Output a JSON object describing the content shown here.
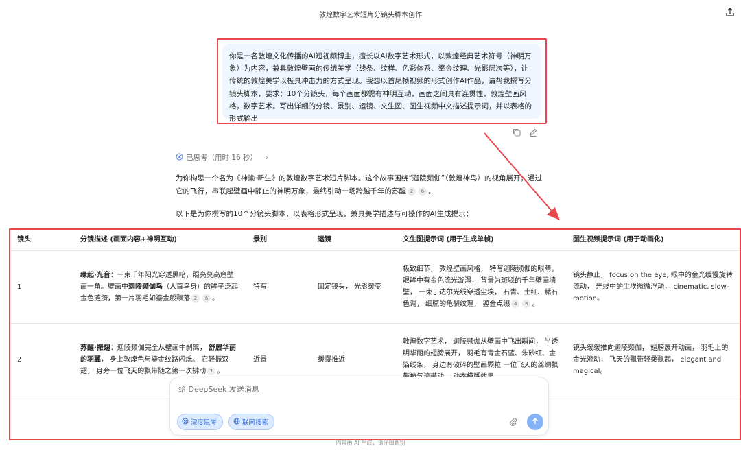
{
  "header": {
    "title": "敦煌数字艺术短片分镜头脚本创作"
  },
  "user_message": {
    "text": "你是一名敦煌文化传播的AI短视频博主，擅长以AI数字艺术形式，以敦煌经典艺术符号（神明万象）为内容，兼具敦煌壁画的传统美学（线条、纹样、色彩体系、鎏金纹理、光影层次等），让传统的敦煌美学以极具冲击力的方式呈现。我想以首尾帧视频的形式创作AI作品，请帮我撰写分镜头脚本，要求：10个分镜头，每个画面都需有神明互动，画面之间具有连贯性，敦煌壁画风格，数字艺术。写出详细的分镜、景别、运镜、文生图、图生视频中文描述提示词，并以表格的形式输出"
  },
  "thinking": {
    "label": "已思考（用时 16 秒）",
    "chevron": "›"
  },
  "answer": {
    "para1_a": "为你构思一个名为《神谕·新生》的敦煌数字艺术短片脚本。这个故事围绕“迦陵频伽”（敦煌神鸟）的视角展开，通过它的飞行，串联起壁画中静止的神明万象，最终引动一场跨越千年的苏醒",
    "para1_cite1": "2",
    "para1_cite2": "6",
    "para1_end": "。",
    "para2": "以下是为你撰写的10个分镜头脚本，以表格形式呈现，兼具美学描述与可操作的AI生成提示："
  },
  "table": {
    "headers": {
      "shot": "镜头",
      "desc": "分镜描述 (画面内容+神明互动)",
      "scene": "景别",
      "move": "运镜",
      "t2i": "文生图提示词 (用于生成单帧)",
      "i2v": "图生视频提示词 (用于动画化)"
    },
    "rows": [
      {
        "shot": "1",
        "desc_bold1": "缘起·光音",
        "desc_t1": "：一束千年阳光穿透黑暗，照亮莫高窟壁画一角。壁画中",
        "desc_bold2": "迦陵频伽鸟",
        "desc_t2": "（人首鸟身）的眸子泛起金色涟漪，第一片羽毛如鎏金般飘落",
        "cite1": "2",
        "cite2": "6",
        "desc_end": "。",
        "scene": "特写",
        "move": "固定镜头， 光影缓变",
        "t2i": "极致细节， 敦煌壁画风格， 特写迦陵频伽的眼睛， 眼眸中有金色流光漩涡， 背景为斑驳的千年壁画墙壁， 一束丁达尔光线穿透尘埃， 石青、土红、赭石色调， 细腻的龟裂纹理， 鎏金点缀",
        "t2i_cite1": "4",
        "t2i_cite2": "8",
        "t2i_end": "。",
        "i2v": "镜头静止， focus on the eye, 眼中的金光缓慢旋转流动， 光线中的尘埃微微浮动， cinematic, slow-motion。"
      },
      {
        "shot": "2",
        "desc_bold1": "苏醒·振翅",
        "desc_t1": "：迦陵频伽完全从壁画中剥离， ",
        "desc_bold2": "舒展华丽的羽翼",
        "desc_t2": "， 身上敦煌色与鎏金纹路闪烁。 它轻振双翅， 身旁一位",
        "desc_bold3": "飞天",
        "desc_t3": "的飘带随之第一次拂动",
        "cite1": "1",
        "desc_end": "。",
        "scene": "近景",
        "move": "缓慢推近",
        "t2i": "敦煌数字艺术， 迦陵频伽从壁画中飞出瞬间， 半透明华丽的翅膀展开， 羽毛有青金石蓝、朱砂红、金箔线条， 身边有破碎的壁画颗粒 一位飞天的丝绸飘带被气流带动， 动态模糊效果，",
        "i2v": "镜头缓缓推向迦陵频伽， 翅膀展开动画， 羽毛上的金光流动， 飞天的飘带轻柔飘起， elegant and magical。"
      }
    ]
  },
  "composer": {
    "placeholder": "给 DeepSeek 发送消息",
    "deep_think": "深度思考",
    "web_search": "联网搜索"
  },
  "disclaimer": "内容由 AI 生成，请仔细甄别",
  "colors": {
    "annotation_red": "#e8484d",
    "bubble_bg": "#eff6ff",
    "chip_blue": "#3a6fd8",
    "send_blue": "#86b3f8"
  }
}
